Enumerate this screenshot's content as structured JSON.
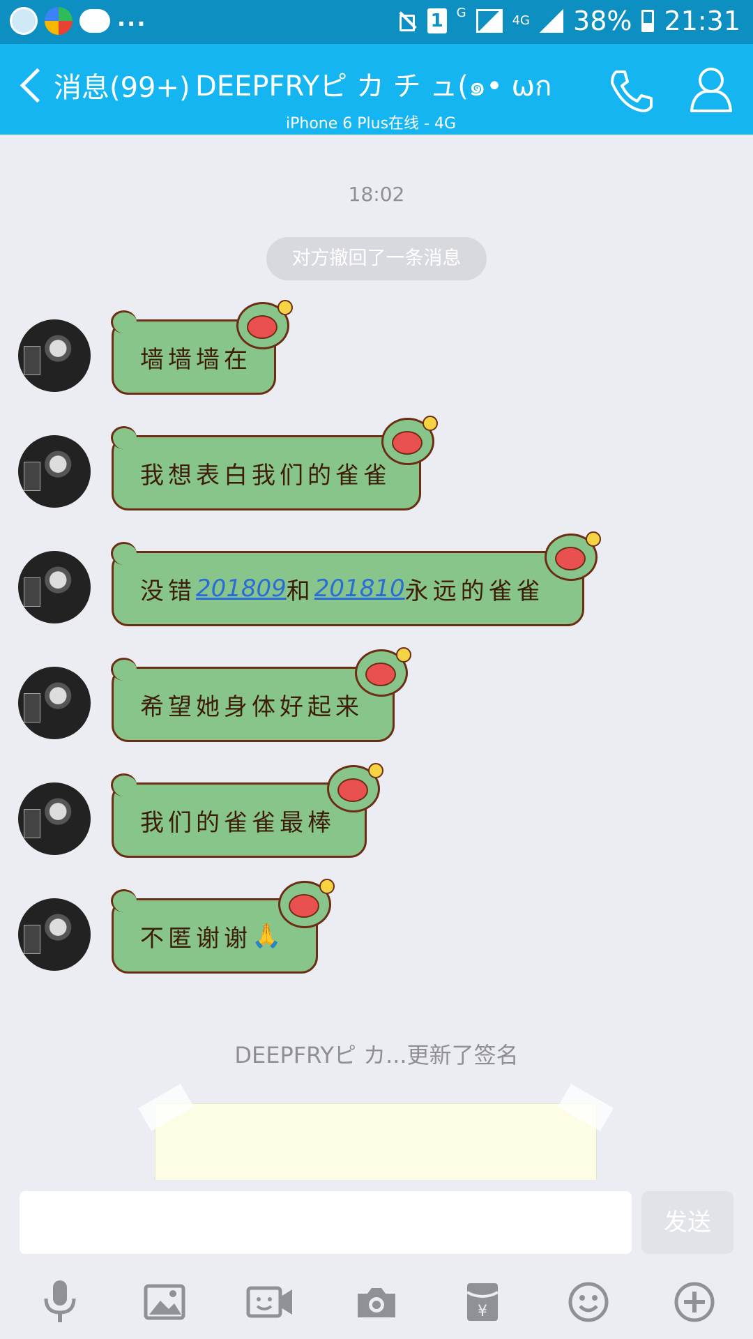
{
  "status_bar": {
    "notifications_more": "...",
    "sim_slot": "1",
    "network_g": "G",
    "network_4g": "4G",
    "battery_percent": "38%",
    "time": "21:31"
  },
  "header": {
    "back_label": "消息(99+)",
    "contact_name": "DEEPFRYピ カ チ ュ(๑• ωก",
    "contact_status": "iPhone 6 Plus在线 - 4G"
  },
  "chat": {
    "timestamp": "18:02",
    "system_notice": "对方撤回了一条消息",
    "messages": [
      {
        "text": "墙墙墙在"
      },
      {
        "text": "我想表白我们的雀雀"
      },
      {
        "prefix": "没错",
        "link1": "201809",
        "middle": "和",
        "link2": "201810",
        "suffix": "永远的雀雀"
      },
      {
        "text": "希望她身体好起来"
      },
      {
        "text": "我们的雀雀最棒"
      },
      {
        "text": "不匿谢谢",
        "emoji": "🙏"
      }
    ],
    "signature_update": "DEEPFRYピ カ...更新了签名"
  },
  "input": {
    "placeholder": "",
    "send_label": "发送"
  },
  "toolbar": {
    "icons": [
      "microphone-icon",
      "image-icon",
      "video-call-icon",
      "camera-icon",
      "red-packet-icon",
      "emoji-icon",
      "plus-icon"
    ]
  },
  "colors": {
    "title_bar": "#14b5f1",
    "status_bar": "#0d8fc2",
    "bubble_fill": "#88c58a",
    "bubble_border": "#6b2e14",
    "link": "#2a6dd7"
  }
}
